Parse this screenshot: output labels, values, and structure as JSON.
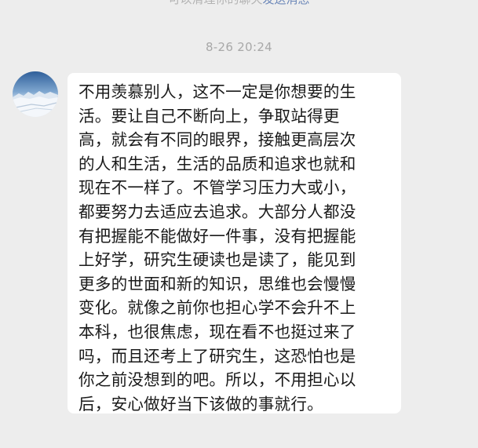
{
  "header": {
    "partial_prefix": "可以清理你的聊天",
    "partial_link": "发送消息"
  },
  "chat": {
    "timestamp": "8-26 20:24",
    "message": {
      "avatar_icon": "snowy-landscape-avatar-icon",
      "lines": [
        "不用羡慕别人，这不一定是你想要的生",
        "活。要让自己不断向上，争取站得更",
        "高，就会有不同的眼界，接触更高层次",
        "的人和生活，生活的品质和追求也就和",
        "现在不一样了。不管学习压力大或小，",
        "都要努力去适应去追求。大部分人都没",
        "有把握能不能做好一件事，没有把握能",
        "上好学，研究生硬读也是读了，能见到",
        "更多的世面和新的知识，思维也会慢慢",
        "变化。就像之前你也担心学不会升不上",
        "本科，也很焦虑，现在看不也挺过来了",
        "吗，而且还考上了研究生，这恐怕也是",
        "你之前没想到的吧。所以，不用担心以",
        "后，安心做好当下该做的事就行。"
      ]
    }
  },
  "colors": {
    "background": "#ededed",
    "bubble": "#ffffff",
    "timestamp_text": "#a8a8a8",
    "message_text": "#1a1a1a",
    "link": "#6a86b8"
  }
}
